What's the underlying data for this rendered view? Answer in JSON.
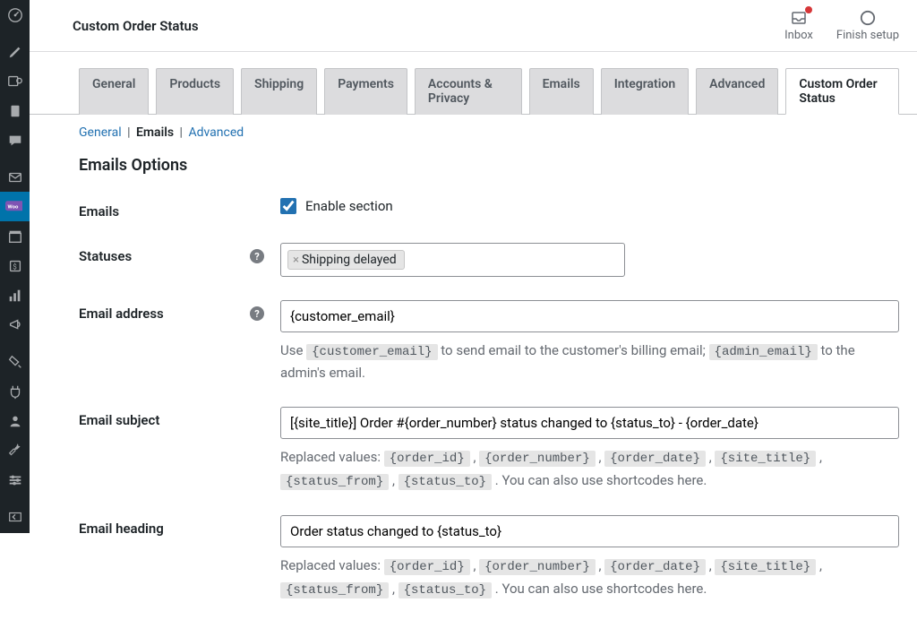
{
  "header": {
    "title": "Custom Order Status",
    "inbox": "Inbox",
    "finish": "Finish setup"
  },
  "tabs": [
    {
      "label": "General"
    },
    {
      "label": "Products"
    },
    {
      "label": "Shipping"
    },
    {
      "label": "Payments"
    },
    {
      "label": "Accounts & Privacy"
    },
    {
      "label": "Emails"
    },
    {
      "label": "Integration"
    },
    {
      "label": "Advanced"
    },
    {
      "label": "Custom Order Status",
      "active": true
    }
  ],
  "subnav": {
    "general": "General",
    "emails": "Emails",
    "advanced": "Advanced"
  },
  "section_heading": "Emails Options",
  "fields": {
    "emails_label": "Emails",
    "enable_label": "Enable section",
    "enable_checked": true,
    "statuses_label": "Statuses",
    "status_token": "Shipping delayed",
    "email_address_label": "Email address",
    "email_address_value": "{customer_email}",
    "email_address_help_prefix": "Use ",
    "code_customer_email": "{customer_email}",
    "email_address_help_mid": " to send email to the customer's billing email; ",
    "code_admin_email": "{admin_email}",
    "email_address_help_suffix": " to the admin's email.",
    "email_subject_label": "Email subject",
    "email_subject_value": "[{site_title}] Order #{order_number} status changed to {status_to} - {order_date}",
    "replaced_prefix": "Replaced values: ",
    "code_order_id": "{order_id}",
    "code_order_number": "{order_number}",
    "code_order_date": "{order_date}",
    "code_site_title": "{site_title}",
    "code_status_from": "{status_from}",
    "code_status_to": "{status_to}",
    "replaced_suffix": " . You can also use shortcodes here.",
    "comma": " , ",
    "email_heading_label": "Email heading",
    "email_heading_value": "Order status changed to {status_to}"
  }
}
